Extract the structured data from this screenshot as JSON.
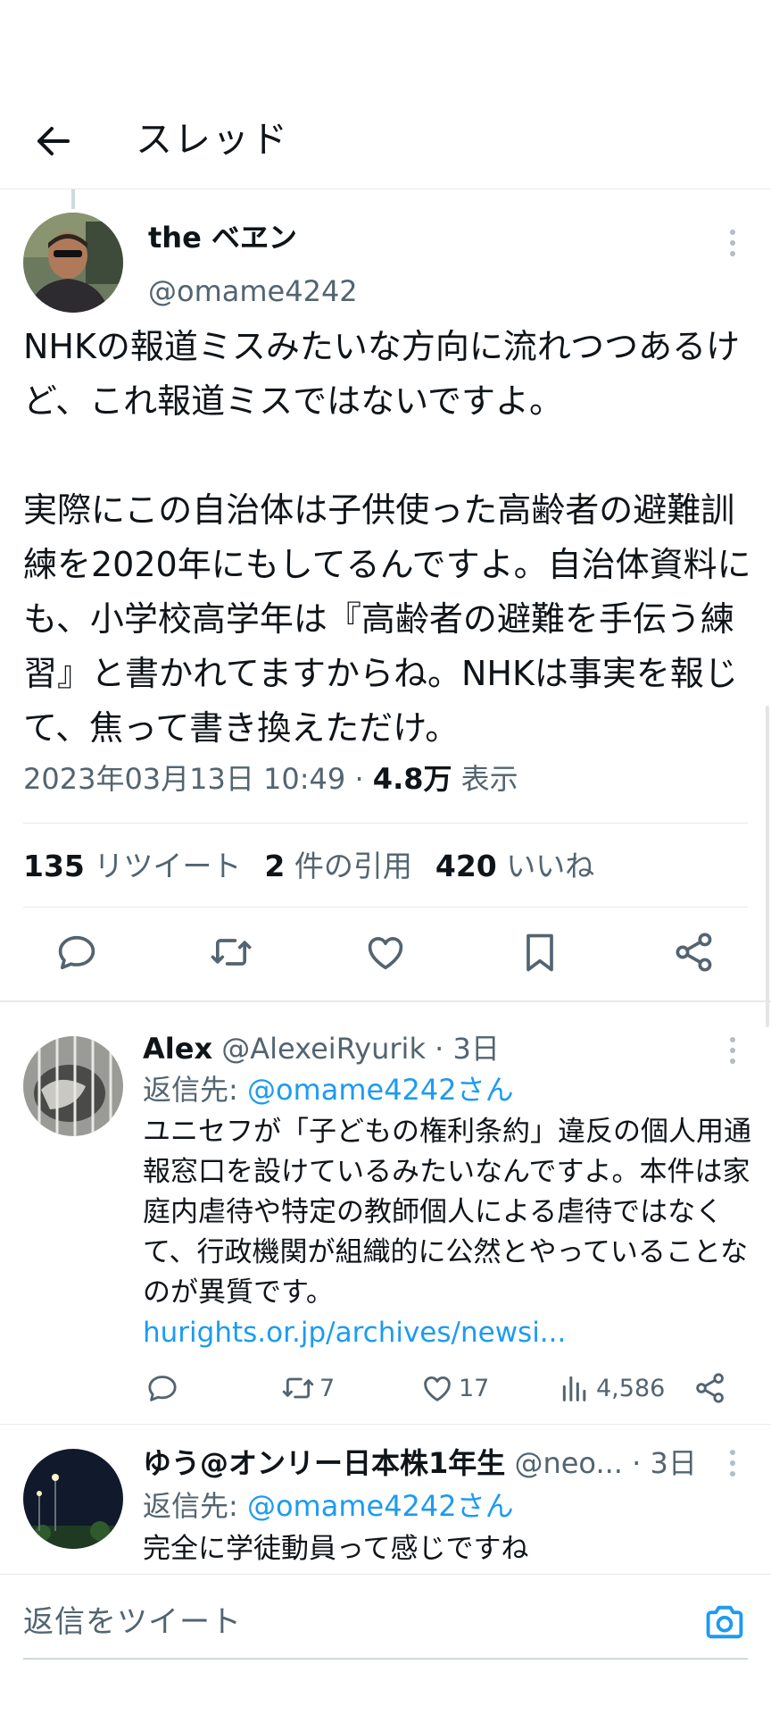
{
  "header": {
    "title": "スレッド"
  },
  "main_tweet": {
    "name": "the ベヱン",
    "handle": "@omame4242",
    "text": "NHKの報道ミスみたいな方向に流れつつあるけど、これ報道ミスではないですよ。\n\n実際にこの自治体は子供使った高齢者の避難訓練を2020年にもしてるんですよ。自治体資料にも、小学校高学年は『高齢者の避難を手伝う練習』と書かれてますからね。NHKは事実を報じて、焦って書き換えただけ。",
    "date": "2023年03月13日 10:49 · ",
    "views": "4.8万",
    "views_label": " 表示"
  },
  "stats": {
    "retweets": "135",
    "retweets_label": " リツイート",
    "quotes": "2",
    "quotes_label": " 件の引用",
    "likes": "420",
    "likes_label": " いいね"
  },
  "replies": [
    {
      "name": "Alex",
      "handle": " @AlexeiRyurik",
      "time": " · 3日",
      "reply_to_label": "返信先: ",
      "reply_to": "@omame4242さん",
      "text": "ユニセフが「子どもの権利条約」違反の個人用通報窓口を設けているみたいなんですよ。本件は家庭内虐待や特定の教師個人による虐待ではなくて、行政機関が組織的に公然とやっていることなのが異質です。",
      "link": "hurights.or.jp/archives/newsi...",
      "retweets": "7",
      "likes": "17",
      "views": "4,586"
    },
    {
      "name": "ゆう@オンリー日本株1年生",
      "handle": " @neo...",
      "time": " · 3日",
      "reply_to_label": "返信先: ",
      "reply_to": "@omame4242さん",
      "text": "完全に学徒動員って感じですね"
    }
  ],
  "compose": {
    "placeholder": "返信をツイート"
  },
  "colors": {
    "link": "#1d9bf0",
    "secondary": "#536471",
    "text": "#0f1419"
  }
}
